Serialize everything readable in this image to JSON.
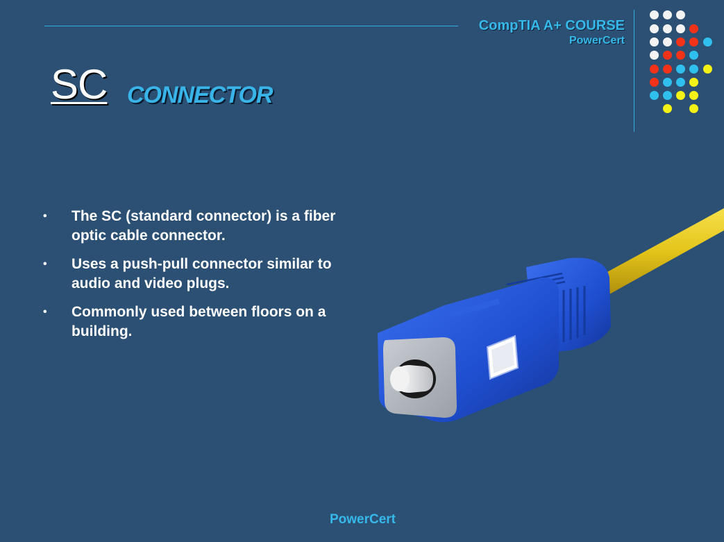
{
  "header": {
    "course": "CompTIA A+ COURSE",
    "brand": "PowerCert"
  },
  "title": {
    "main": "SC",
    "sub": "CONNECTOR"
  },
  "bullets": [
    "The SC (standard connector) is a fiber optic cable connector.",
    "Uses a push-pull  connector similar to audio and video plugs.",
    "Commonly used between floors on a building."
  ],
  "bullet_symbol": "•",
  "footer": {
    "brand": "PowerCert"
  },
  "colors": {
    "background": "#2b5074",
    "accent": "#36b9ea",
    "dot_white": "#f3f3f3",
    "dot_red": "#f2331a",
    "dot_blue": "#2fc0ee",
    "dot_yellow": "#f4f116",
    "connector_blue": "#1f4fd0",
    "cable_yellow": "#e3c41a"
  },
  "illustration": {
    "subject": "sc-fiber-optic-connector-image"
  }
}
